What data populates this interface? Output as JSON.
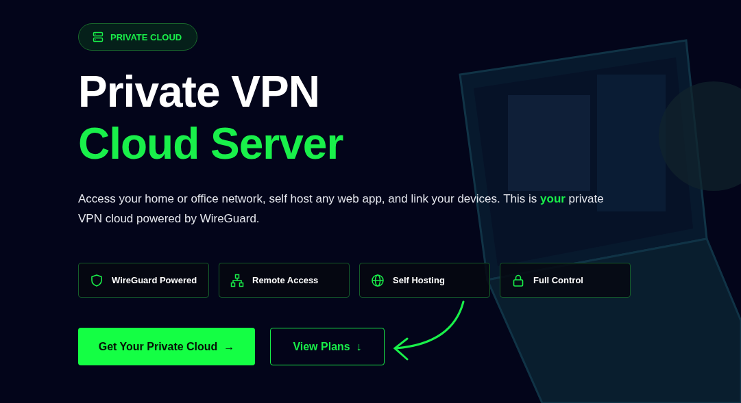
{
  "badge": {
    "label": "PRIVATE CLOUD"
  },
  "heading": {
    "line_1": "Private VPN",
    "line_2": "Cloud Server"
  },
  "description": "Access your home or office network, self host any web app, and link your devices. This is **your** private VPN cloud powered by WireGuard.",
  "features": [
    {
      "kind": "shield",
      "label": "WireGuard Powered"
    },
    {
      "kind": "network",
      "label": "Remote Access"
    },
    {
      "kind": "globe",
      "label": "Self Hosting"
    },
    {
      "kind": "lock",
      "label": "Full Control"
    }
  ],
  "buttons": [
    {
      "kind": "primary",
      "label": "Get Your Private Cloud",
      "arrow": "→"
    },
    {
      "kind": "outline",
      "label": "View Plans",
      "arrow": "↓"
    }
  ]
}
